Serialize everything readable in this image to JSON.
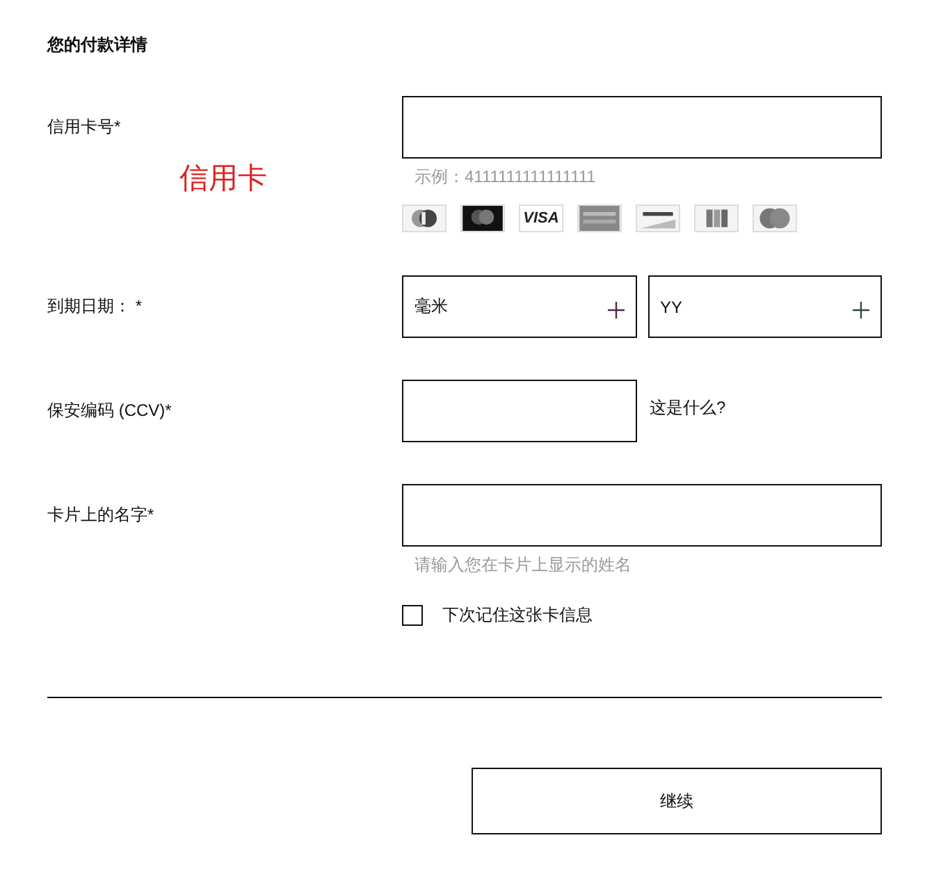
{
  "title": "您的付款详情",
  "annotation": "信用卡",
  "card_number": {
    "label": "信用卡号*",
    "hint": "示例：4111111111111111"
  },
  "card_logos": [
    {
      "kind": "diners"
    },
    {
      "kind": "mastercard"
    },
    {
      "kind": "visa",
      "label": "VISA"
    },
    {
      "kind": "amex"
    },
    {
      "kind": "discover"
    },
    {
      "kind": "jcb"
    },
    {
      "kind": "maestro"
    }
  ],
  "expiry": {
    "label": "到期日期： *",
    "month": "毫米",
    "year": "YY"
  },
  "ccv": {
    "label": "保安编码 (CCV)*",
    "help_link": "这是什么?"
  },
  "name_on_card": {
    "label": "卡片上的名字*",
    "hint": "请输入您在卡片上显示的姓名"
  },
  "remember": {
    "label": "下次记住这张卡信息",
    "checked": false
  },
  "continue_button": "继续"
}
